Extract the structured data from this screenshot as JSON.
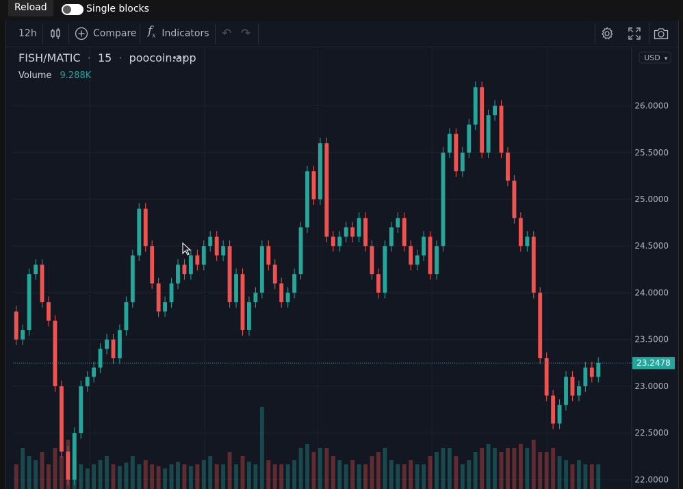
{
  "topbar": {
    "reload_label": "Reload",
    "single_blocks_label": "Single blocks"
  },
  "toolbar": {
    "interval": "12h",
    "compare_label": "Compare",
    "indicators_label": "Indicators"
  },
  "colors": {
    "up": "#26a69a",
    "down": "#ef5350",
    "background": "#131722",
    "grid": "#1e222d"
  },
  "chart_data": {
    "type": "candlestick",
    "legend": {
      "symbol": "FISH/MATIC",
      "interval": "15",
      "source": "poocoin.app",
      "volume_label": "Volume",
      "volume_value": "9.288K"
    },
    "currency": "USD",
    "last_price": "23.2478",
    "y_ticks": [
      "26.0000",
      "25.5000",
      "25.0000",
      "24.5000",
      "24.0000",
      "23.5000",
      "23.0000",
      "22.5000",
      "22.0000"
    ],
    "ylim": [
      21.9,
      26.4
    ],
    "candles": [
      [
        23.8,
        23.5
      ],
      [
        23.5,
        23.6
      ],
      [
        23.6,
        24.2
      ],
      [
        24.2,
        24.3
      ],
      [
        24.3,
        23.9
      ],
      [
        23.9,
        23.7
      ],
      [
        23.7,
        23.0
      ],
      [
        23.0,
        22.3
      ],
      [
        22.3,
        22.0
      ],
      [
        22.0,
        22.5
      ],
      [
        22.5,
        23.0
      ],
      [
        23.0,
        23.1
      ],
      [
        23.1,
        23.2
      ],
      [
        23.2,
        23.4
      ],
      [
        23.4,
        23.5
      ],
      [
        23.5,
        23.3
      ],
      [
        23.3,
        23.6
      ],
      [
        23.6,
        23.9
      ],
      [
        23.9,
        24.4
      ],
      [
        24.4,
        24.9
      ],
      [
        24.9,
        24.5
      ],
      [
        24.5,
        24.1
      ],
      [
        24.1,
        23.8
      ],
      [
        23.8,
        23.9
      ],
      [
        23.9,
        24.1
      ],
      [
        24.1,
        24.3
      ],
      [
        24.3,
        24.2
      ],
      [
        24.2,
        24.4
      ],
      [
        24.4,
        24.3
      ],
      [
        24.3,
        24.5
      ],
      [
        24.5,
        24.6
      ],
      [
        24.6,
        24.4
      ],
      [
        24.4,
        24.5
      ],
      [
        24.5,
        23.9
      ],
      [
        23.9,
        24.2
      ],
      [
        24.2,
        23.6
      ],
      [
        23.6,
        23.9
      ],
      [
        23.9,
        24.0
      ],
      [
        24.0,
        24.5
      ],
      [
        24.5,
        24.3
      ],
      [
        24.3,
        24.1
      ],
      [
        24.1,
        23.9
      ],
      [
        23.9,
        24.0
      ],
      [
        24.0,
        24.2
      ],
      [
        24.2,
        24.7
      ],
      [
        24.7,
        25.3
      ],
      [
        25.3,
        25.0
      ],
      [
        25.0,
        25.6
      ],
      [
        25.6,
        24.6
      ],
      [
        24.6,
        24.5
      ],
      [
        24.5,
        24.6
      ],
      [
        24.6,
        24.7
      ],
      [
        24.7,
        24.6
      ],
      [
        24.6,
        24.8
      ],
      [
        24.8,
        24.5
      ],
      [
        24.5,
        24.2
      ],
      [
        24.2,
        24.0
      ],
      [
        24.0,
        24.5
      ],
      [
        24.5,
        24.7
      ],
      [
        24.7,
        24.8
      ],
      [
        24.8,
        24.5
      ],
      [
        24.5,
        24.3
      ],
      [
        24.3,
        24.4
      ],
      [
        24.4,
        24.6
      ],
      [
        24.6,
        24.2
      ],
      [
        24.2,
        24.5
      ],
      [
        24.5,
        25.5
      ],
      [
        25.5,
        25.7
      ],
      [
        25.7,
        25.3
      ],
      [
        25.3,
        25.5
      ],
      [
        25.5,
        25.8
      ],
      [
        25.8,
        26.2
      ],
      [
        26.2,
        25.5
      ],
      [
        25.5,
        25.9
      ],
      [
        25.9,
        26.0
      ],
      [
        26.0,
        25.5
      ],
      [
        25.5,
        25.2
      ],
      [
        25.2,
        24.8
      ],
      [
        24.8,
        24.5
      ],
      [
        24.5,
        24.6
      ],
      [
        24.6,
        24.0
      ],
      [
        24.0,
        23.3
      ],
      [
        23.3,
        22.9
      ],
      [
        22.9,
        22.6
      ],
      [
        22.6,
        22.8
      ],
      [
        22.8,
        23.1
      ],
      [
        23.1,
        22.9
      ],
      [
        22.9,
        23.0
      ],
      [
        23.0,
        23.2
      ],
      [
        23.2,
        23.1
      ],
      [
        23.1,
        23.25
      ]
    ],
    "volumes": [
      0.3,
      0.5,
      0.4,
      0.35,
      0.45,
      0.3,
      0.5,
      0.4,
      0.6,
      0.35,
      0.3,
      0.25,
      0.3,
      0.35,
      0.4,
      0.3,
      0.28,
      0.32,
      0.4,
      0.3,
      0.35,
      0.3,
      0.28,
      0.25,
      0.3,
      0.33,
      0.3,
      0.28,
      0.3,
      0.35,
      0.4,
      0.3,
      0.3,
      0.45,
      0.3,
      0.4,
      0.33,
      0.3,
      1.0,
      0.35,
      0.3,
      0.3,
      0.3,
      0.35,
      0.5,
      0.55,
      0.45,
      0.5,
      0.5,
      0.4,
      0.35,
      0.3,
      0.35,
      0.3,
      0.3,
      0.4,
      0.45,
      0.5,
      0.35,
      0.3,
      0.3,
      0.35,
      0.3,
      0.3,
      0.4,
      0.45,
      0.5,
      0.5,
      0.4,
      0.3,
      0.35,
      0.45,
      0.5,
      0.55,
      0.5,
      0.45,
      0.5,
      0.5,
      0.55,
      0.5,
      0.6,
      0.45,
      0.45,
      0.5,
      0.4,
      0.35,
      0.3,
      0.35,
      0.3,
      0.3,
      0.3
    ]
  }
}
